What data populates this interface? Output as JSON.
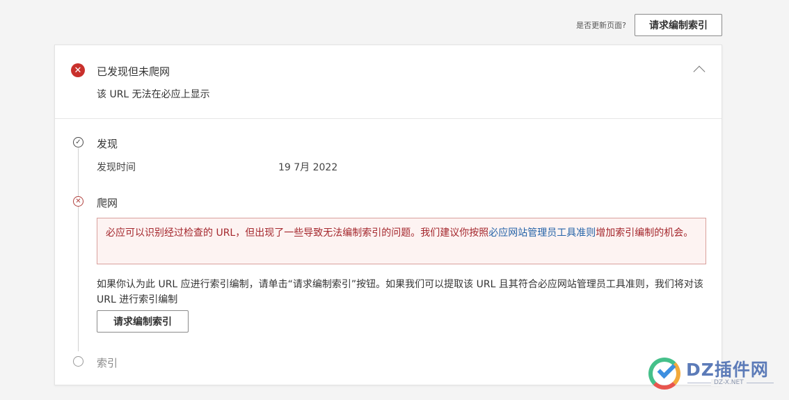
{
  "top_bar": {
    "update_question": "是否更新页面?",
    "request_index_label": "请求编制索引"
  },
  "status": {
    "title": "已发现但未爬网",
    "subtitle": "该 URL 无法在必应上显示",
    "icon": "error-circle-icon"
  },
  "steps": {
    "discover": {
      "title": "发现",
      "icon": "check-circle-icon",
      "row_label": "发现时间",
      "row_value": "19 7月 2022"
    },
    "crawl": {
      "title": "爬网",
      "icon": "x-circle-icon",
      "alert_text_before": "必应可以识别经过检查的 URL，但出现了一些导致无法编制索引的问题。我们建议你按照",
      "alert_link": "必应网站管理员工具准则",
      "alert_text_after": "增加索引编制的机会。",
      "info_text": "如果你认为此 URL 应进行索引编制，请单击“请求编制索引”按钮。如果我们可以提取该 URL 且其符合必应网站管理员工具准则，我们将对该 URL 进行索引编制",
      "button_label": "请求编制索引"
    },
    "index": {
      "title": "索引",
      "icon": "pending-circle-icon"
    }
  },
  "watermark": {
    "brand": "DZ插件网",
    "domain": "DZ-X.NET"
  },
  "colors": {
    "error": "#c9302c",
    "alert_bg": "#fdf3f2",
    "alert_text": "#a4262c",
    "link": "#2563a8"
  }
}
